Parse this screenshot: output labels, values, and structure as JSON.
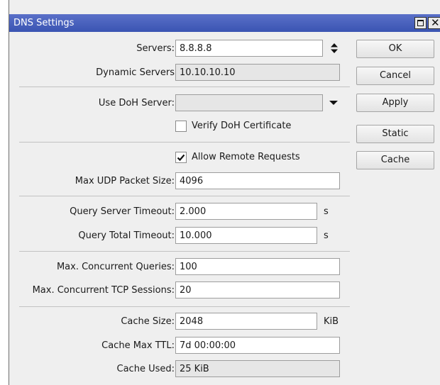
{
  "window": {
    "title": "DNS Settings"
  },
  "fields": {
    "servers": {
      "label": "Servers:",
      "value": "8.8.8.8"
    },
    "dynamic_servers": {
      "label": "Dynamic Servers",
      "value": "10.10.10.10"
    },
    "use_doh_server": {
      "label": "Use DoH Server:",
      "value": ""
    },
    "verify_doh_certificate": {
      "label": "Verify DoH Certificate",
      "checked": false
    },
    "allow_remote_requests": {
      "label": "Allow Remote Requests",
      "checked": true
    },
    "max_udp_packet_size": {
      "label": "Max UDP Packet Size:",
      "value": "4096"
    },
    "query_server_timeout": {
      "label": "Query Server Timeout:",
      "value": "2.000",
      "unit": "s"
    },
    "query_total_timeout": {
      "label": "Query Total Timeout:",
      "value": "10.000",
      "unit": "s"
    },
    "max_concurrent_queries": {
      "label": "Max. Concurrent Queries:",
      "value": "100"
    },
    "max_concurrent_tcp_sessions": {
      "label": "Max. Concurrent TCP Sessions:",
      "value": "20"
    },
    "cache_size": {
      "label": "Cache Size:",
      "value": "2048",
      "unit": "KiB"
    },
    "cache_max_ttl": {
      "label": "Cache Max TTL:",
      "value": "7d 00:00:00"
    },
    "cache_used": {
      "label": "Cache Used:",
      "value": "25 KiB"
    }
  },
  "buttons": {
    "ok": "OK",
    "cancel": "Cancel",
    "apply": "Apply",
    "static": "Static",
    "cache": "Cache"
  },
  "icons": {
    "updown": "updown-arrows-icon",
    "dropdown": "dropdown-triangle-icon",
    "maximize": "maximize-icon",
    "close": "close-icon"
  },
  "colors": {
    "titlebar": "#3a54b2",
    "window_bg": "#efefef",
    "readonly_bg": "#e6e6e6"
  }
}
